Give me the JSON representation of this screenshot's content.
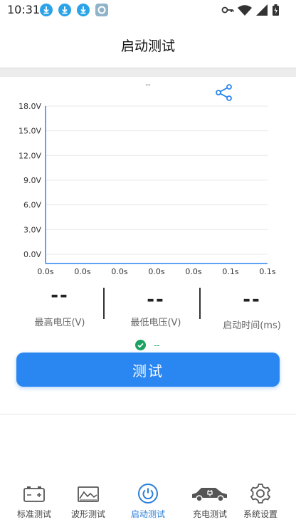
{
  "status_bar": {
    "time": "10:31"
  },
  "header": {
    "title": "启动测试"
  },
  "chart_data": {
    "type": "line",
    "title": "--",
    "y_ticks": [
      "18.0V",
      "15.0V",
      "12.0V",
      "9.0V",
      "6.0V",
      "3.0V",
      "0.0V"
    ],
    "x_ticks": [
      "0.0s",
      "0.0s",
      "0.0s",
      "0.0s",
      "0.0s",
      "0.1s",
      "0.1s"
    ],
    "ylim": [
      0,
      18
    ],
    "series": [],
    "grid": true,
    "accent": "#2a86f0"
  },
  "stats": {
    "max_voltage": {
      "value": "--",
      "label": "最高电压(V)"
    },
    "min_voltage": {
      "value": "--",
      "label": "最低电压(V)"
    },
    "start_time": {
      "value": "--",
      "label": "启动时间(ms)"
    }
  },
  "status": {
    "text": "--",
    "icon": "check-circle-icon"
  },
  "actions": {
    "test_label": "测试"
  },
  "nav": {
    "items": [
      {
        "label": "标准测试",
        "icon": "battery-icon"
      },
      {
        "label": "波形测试",
        "icon": "waveform-icon"
      },
      {
        "label": "启动测试",
        "icon": "power-icon",
        "active": true
      },
      {
        "label": "充电测试",
        "icon": "car-charging-icon"
      },
      {
        "label": "系统设置",
        "icon": "gear-icon"
      }
    ]
  }
}
